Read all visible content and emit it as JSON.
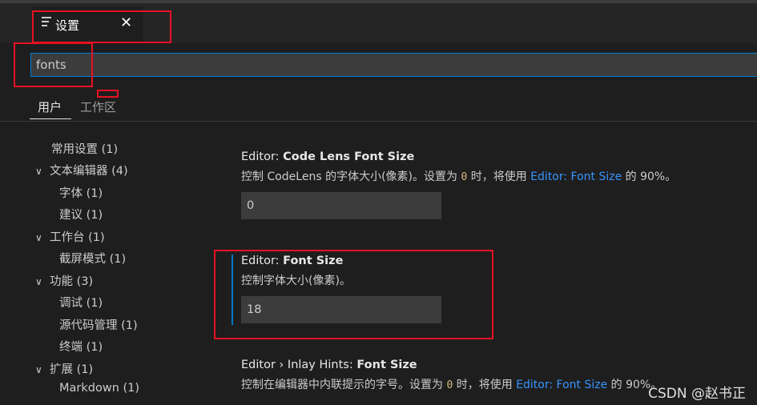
{
  "tab": {
    "title": "设置",
    "close_glyph": "✕",
    "icon": "settings-lines-icon"
  },
  "search": {
    "value": "fonts",
    "placeholder": ""
  },
  "scope_tabs": {
    "user": "用户",
    "workspace": "工作区"
  },
  "toc": {
    "items": [
      {
        "label": "常用设置 (1)",
        "expanded": null
      },
      {
        "label": "文本编辑器 (4)",
        "expanded": true
      },
      {
        "label": "字体 (1)",
        "expanded": null
      },
      {
        "label": "建议 (1)",
        "expanded": null
      },
      {
        "label": "工作台 (1)",
        "expanded": true
      },
      {
        "label": "截屏模式 (1)",
        "expanded": null
      },
      {
        "label": "功能 (3)",
        "expanded": true
      },
      {
        "label": "调试 (1)",
        "expanded": null
      },
      {
        "label": "源代码管理 (1)",
        "expanded": null
      },
      {
        "label": "终端 (1)",
        "expanded": null
      },
      {
        "label": "扩展 (1)",
        "expanded": true
      },
      {
        "label": "Markdown (1)",
        "expanded": null
      }
    ],
    "chevron_glyph": "∨"
  },
  "settings": {
    "code_lens": {
      "category": "Editor: ",
      "name": "Code Lens Font Size",
      "desc_before": "控制 CodeLens 的字体大小(像素)。设置为 ",
      "desc_code": "0",
      "desc_middle": " 时，将使用 ",
      "desc_link": "Editor: Font Size",
      "desc_after": " 的 90%。",
      "value": "0"
    },
    "font_size": {
      "category": "Editor: ",
      "name": "Font Size",
      "desc": "控制字体大小(像素)。",
      "value": "18"
    },
    "inlay_hints": {
      "category": "Editor › Inlay Hints: ",
      "name": "Font Size",
      "desc_before": "控制在编辑器中内联提示的字号。设置为 ",
      "desc_code": "0",
      "desc_middle": " 时，将使用 ",
      "desc_link": "Editor: Font Size",
      "desc_after": " 的 90%。"
    }
  },
  "watermark": "CSDN @赵书正",
  "colors": {
    "accent": "#007acc",
    "link": "#3794ff",
    "annotation": "#e81123"
  }
}
